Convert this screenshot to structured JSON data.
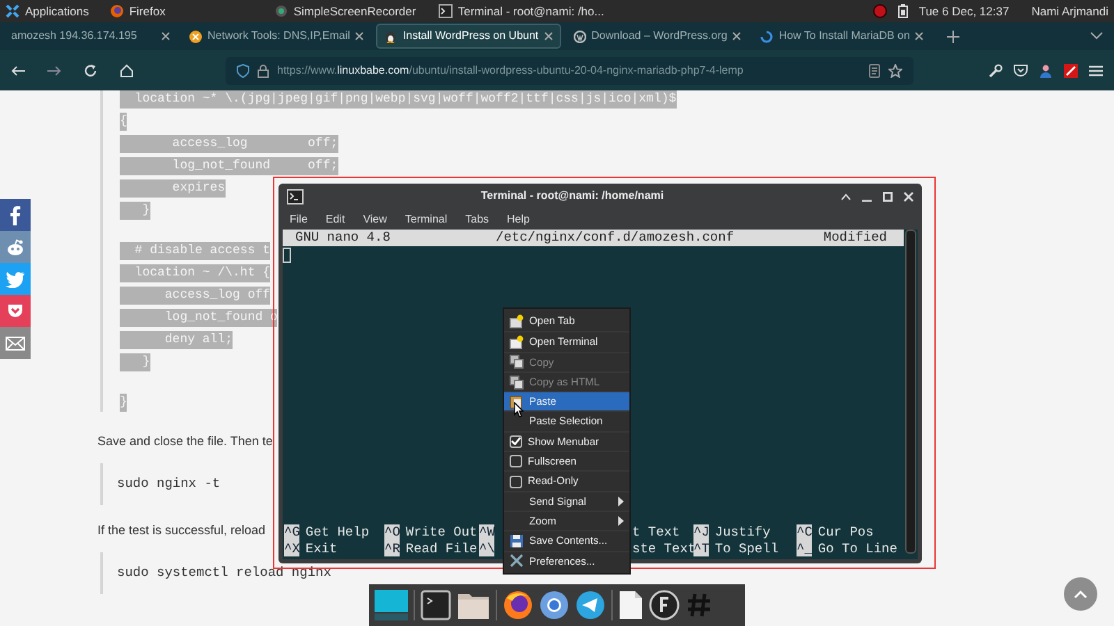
{
  "top_panel": {
    "menu": "Applications",
    "windows": [
      {
        "title": "Firefox",
        "kind": "firefox"
      },
      {
        "title": "SimpleScreenRecorder",
        "kind": "recorder"
      },
      {
        "title": "Terminal - root@nami: /ho...",
        "kind": "terminal"
      }
    ],
    "clock": "Tue  6 Dec, 12:37",
    "user": "Nami Arjmandi"
  },
  "browser": {
    "tabs": [
      {
        "label": "amozesh 194.36.174.195",
        "selected": false,
        "kind": "plain"
      },
      {
        "label": "Network Tools: DNS,IP,Email",
        "selected": false,
        "kind": "ball"
      },
      {
        "label": "Install WordPress on Ubunt",
        "selected": true,
        "kind": "penguin"
      },
      {
        "label": "Download – WordPress.org",
        "selected": false,
        "kind": "wp"
      },
      {
        "label": "How To Install MariaDB on",
        "selected": false,
        "kind": "spinner"
      }
    ],
    "url": {
      "scheme": "https://www.",
      "host": "linuxbabe.com",
      "path": "/ubuntu/install-wordpress-ubuntu-20-04-nginx-mariadb-php7-4-lemp"
    }
  },
  "page": {
    "code_groups": [
      [
        "  location ~* \\.(jpg|jpeg|gif|png|webp|svg|woff|woff2|ttf|css|js|ico|xml)$",
        "{",
        "       access_log        off;",
        "       log_not_found     off;",
        "       expires",
        "   }"
      ],
      [
        "  # disable access t",
        "  location ~ /\\.ht {",
        "      access_log off",
        "      log_not_found o",
        "      deny all;",
        "   }"
      ],
      [
        "}"
      ]
    ],
    "blocks": [
      {
        "kind": "paragraph",
        "text": "Save and close the file. Then te"
      },
      {
        "kind": "code",
        "text": "sudo nginx -t"
      },
      {
        "kind": "paragraph",
        "text": "If the test is successful, reload"
      },
      {
        "kind": "code",
        "text": "sudo systemctl reload nginx"
      }
    ]
  },
  "share_buttons": [
    {
      "kind": "facebook",
      "color": "#3b5998"
    },
    {
      "kind": "reddit",
      "color": "#6f8fb0"
    },
    {
      "kind": "twitter",
      "color": "#1da1f2"
    },
    {
      "kind": "pocket",
      "color": "#e4405a"
    },
    {
      "kind": "email",
      "color": "#8a8a8a"
    }
  ],
  "terminal": {
    "title": "Terminal - root@nami: /home/nami",
    "menu": [
      "File",
      "Edit",
      "View",
      "Terminal",
      "Tabs",
      "Help"
    ],
    "nano": {
      "version": "GNU nano 4.8",
      "file": "/etc/nginx/conf.d/amozesh.conf",
      "status": "Modified"
    },
    "shortcuts": [
      [
        {
          "key": "^G",
          "label": "Get Help"
        },
        {
          "key": "^O",
          "label": "Write Out"
        },
        {
          "key": "^W"
        },
        {
          "label": "t Text"
        },
        {
          "key": "^J",
          "label": "Justify"
        },
        {
          "key": "^C",
          "label": "Cur Pos"
        }
      ],
      [
        {
          "key": "^X",
          "label": "Exit"
        },
        {
          "key": "^R",
          "label": "Read File"
        },
        {
          "key": "^\\"
        },
        {
          "label": "ste Text"
        },
        {
          "key": "^T",
          "label": "To Spell"
        },
        {
          "key": "^_",
          "label": "Go To Line"
        }
      ]
    ]
  },
  "context_menu": [
    {
      "kind": "new-tab",
      "label": "Open Tab",
      "disabled": false,
      "highlighted": false
    },
    {
      "kind": "new-window",
      "label": "Open Terminal",
      "disabled": false,
      "highlighted": false
    },
    {
      "kind": "copy",
      "label": "Copy",
      "disabled": true,
      "highlighted": false
    },
    {
      "kind": "copy",
      "label": "Copy as HTML",
      "disabled": true,
      "highlighted": false
    },
    {
      "kind": "paste",
      "label": "Paste",
      "disabled": false,
      "highlighted": true
    },
    {
      "kind": "plain",
      "label": "Paste Selection",
      "disabled": false,
      "highlighted": false
    },
    {
      "kind": "check",
      "label": "Show Menubar",
      "checked": true
    },
    {
      "kind": "check",
      "label": "Fullscreen",
      "checked": false
    },
    {
      "kind": "check",
      "label": "Read-Only",
      "checked": false
    },
    {
      "kind": "submenu",
      "label": "Send Signal"
    },
    {
      "kind": "submenu",
      "label": "Zoom"
    },
    {
      "kind": "save",
      "label": "Save Contents...",
      "disabled": false,
      "highlighted": false
    },
    {
      "kind": "tools",
      "label": "Preferences...",
      "disabled": false,
      "highlighted": false
    }
  ],
  "dock": [
    {
      "kind": "desktop"
    },
    {
      "kind": "separator"
    },
    {
      "kind": "terminal"
    },
    {
      "kind": "folder"
    },
    {
      "kind": "separator"
    },
    {
      "kind": "firefox"
    },
    {
      "kind": "chromium"
    },
    {
      "kind": "telegram"
    },
    {
      "kind": "separator"
    },
    {
      "kind": "document"
    },
    {
      "kind": "f-circle"
    },
    {
      "kind": "hashtag"
    }
  ]
}
